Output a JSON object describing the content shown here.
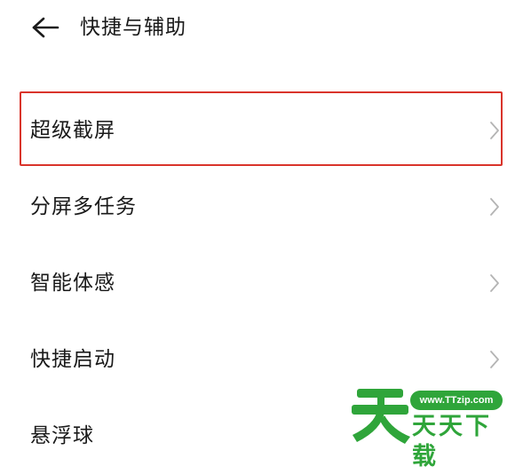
{
  "header": {
    "back_icon": "arrow-left-icon",
    "title": "快捷与辅助"
  },
  "menu": {
    "items": [
      {
        "label": "超级截屏",
        "icon": "chevron-right-icon",
        "highlighted": true
      },
      {
        "label": "分屏多任务",
        "icon": "chevron-right-icon"
      },
      {
        "label": "智能体感",
        "icon": "chevron-right-icon"
      },
      {
        "label": "快捷启动",
        "icon": "chevron-right-icon"
      },
      {
        "label": "悬浮球",
        "icon": "chevron-right-icon"
      }
    ]
  },
  "highlight_color": "#d9342b",
  "watermark": {
    "url": "www.TTzip.com",
    "text": "天天下载",
    "color": "#2fa53a"
  }
}
